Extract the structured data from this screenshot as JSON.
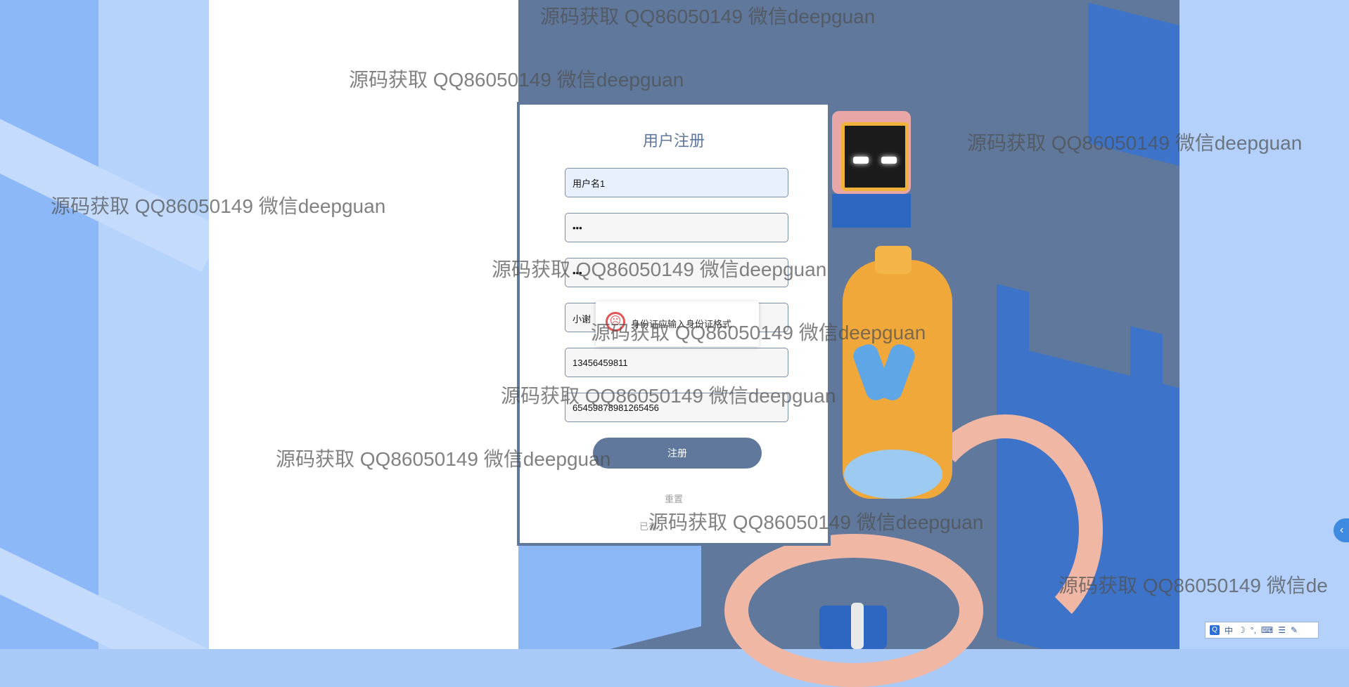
{
  "form": {
    "title": "用户注册",
    "username_value": "用户名1",
    "password_value": "•••",
    "confirm_password_value": "•••",
    "name_value": "小谢",
    "phone_value": "13456459811",
    "id_card_value": "654598789812654​56",
    "validation_message": "身份证应输入身份证格式",
    "submit_label": "注册",
    "reset_label": "重置",
    "login_link": "已有"
  },
  "watermark": {
    "text": "源码获取 QQ86050149 微信deepguan",
    "text_cut": "源码获取 QQ86050149 微信de"
  },
  "side_tab_icon": "chevron-left-icon",
  "ime_toolbar": {
    "lang": "中",
    "items": [
      "moon-icon",
      "punctuation-icon",
      "keyboard-icon",
      "menu-icon",
      "wrench-icon"
    ]
  },
  "colors": {
    "primary": "#5f789c",
    "bg_blue": "#8db8f8",
    "accent_blue": "#3d74c9"
  }
}
